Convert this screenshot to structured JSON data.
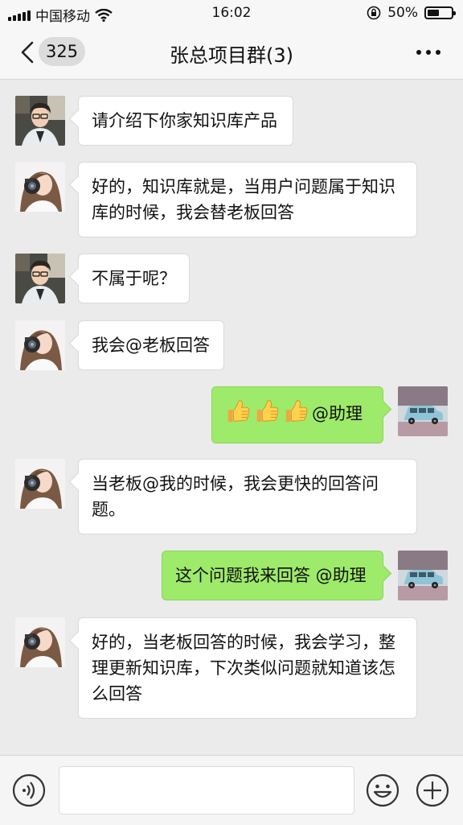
{
  "status_bar": {
    "carrier": "中国移动",
    "time": "16:02",
    "battery_percent": "50%",
    "battery_level": 0.5
  },
  "nav": {
    "unread_count": "325",
    "title": "张总项目群(3)"
  },
  "messages": [
    {
      "side": "left",
      "avatar": "male-avatar",
      "text": "请介绍下你家知识库产品"
    },
    {
      "side": "left",
      "avatar": "female-avatar",
      "text": "好的，知识库就是，当用户问题属于知识库的时候，我会替老板回答"
    },
    {
      "side": "left",
      "avatar": "male-avatar",
      "text": "不属于呢？"
    },
    {
      "side": "left",
      "avatar": "female-avatar",
      "text": "我会@老板回答"
    },
    {
      "side": "right",
      "avatar": "car-avatar",
      "emoji": "thumbs-up x3",
      "text": "@助理"
    },
    {
      "side": "left",
      "avatar": "female-avatar",
      "text": "当老板@我的时候，我会更快的回答问题。"
    },
    {
      "side": "right",
      "avatar": "car-avatar",
      "text": "这个问题我来回答 @助理"
    },
    {
      "side": "left",
      "avatar": "female-avatar",
      "text": "好的，当老板回答的时候，我会学习，整理更新知识库，下次类似问题就知道该怎么回答"
    }
  ],
  "input_bar": {
    "text_value": "",
    "icons": [
      "voice-icon",
      "emoji-icon",
      "plus-icon"
    ]
  },
  "colors": {
    "background": "#ebebeb",
    "sent_bubble": "#9eea6a",
    "received_bubble": "#ffffff"
  }
}
